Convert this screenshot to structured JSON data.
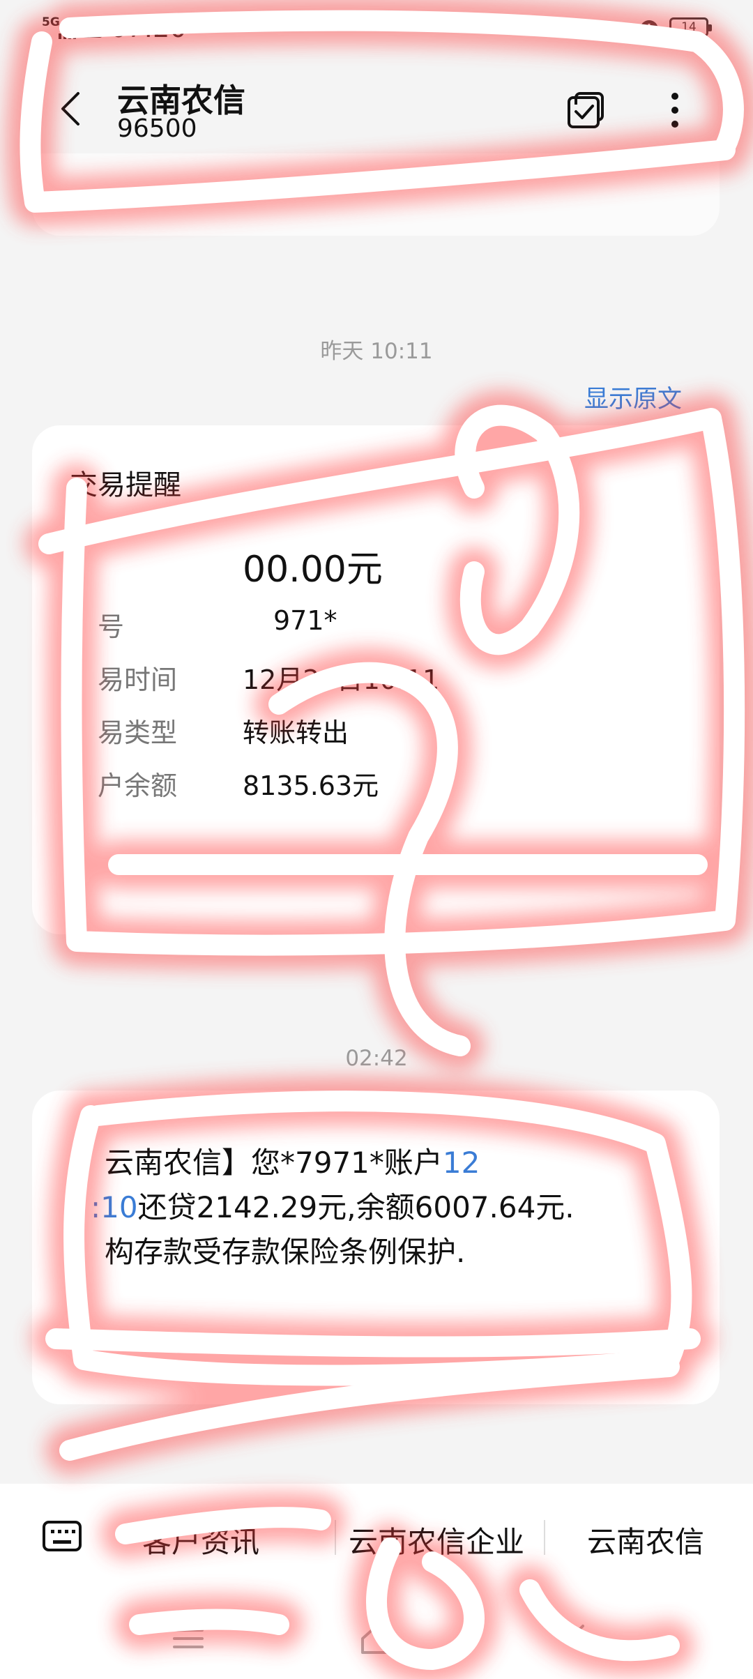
{
  "status_bar": {
    "network": "5G",
    "hd": "HD",
    "time": "07:20",
    "battery": "14"
  },
  "header": {
    "title": "云南农信",
    "number": "96500"
  },
  "messages": [
    {
      "timestamp": "昨天 10:11",
      "show_original": "显示原文",
      "card_title": "交易提醒",
      "amount_text": "00.00元",
      "rows": [
        {
          "label": "号",
          "value": "971*"
        },
        {
          "label": "易时间",
          "value": "12月20日10:11"
        },
        {
          "label": "易类型",
          "value": "转账转出"
        },
        {
          "label": "户余额",
          "value": "8135.63元"
        }
      ]
    },
    {
      "timestamp": "02:42",
      "line1_prefix": "云南农信】您*7971*账户",
      "line1_link": "12",
      "line2_link": ":10",
      "line2_rest": "还贷2142.29元,余额6007.64元.",
      "line3": "构存款受存款保险条例保护."
    }
  ],
  "bottom_menu": {
    "items": [
      "客户资讯",
      "云南农信企业",
      "云南农信"
    ]
  },
  "icons": {
    "back": "back-arrow-icon",
    "multi_select": "multi-select-check-icon",
    "more": "more-vertical-icon",
    "keyboard": "keyboard-icon",
    "alarm": "alarm-icon",
    "nav_menu": "nav-menu-icon",
    "nav_home": "nav-home-icon",
    "nav_back": "nav-back-icon"
  },
  "colors": {
    "accent": "#3a7cd5",
    "scribble_glow": "#ff3b3b",
    "background": "#f4f4f4"
  }
}
